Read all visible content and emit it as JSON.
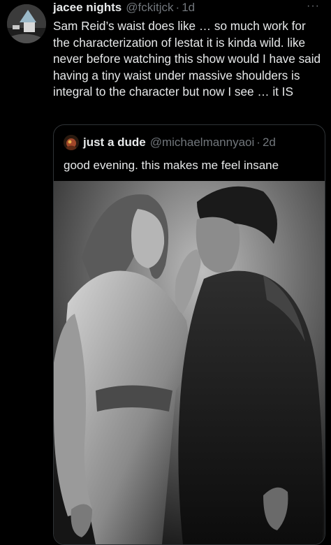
{
  "tweet": {
    "author_name": "jacee nights",
    "author_handle": "@fckitjck",
    "separator": "·",
    "time": "1d",
    "more_label": "···",
    "text": "Sam Reid’s waist does like … so much work for the characterization of lestat it is kinda wild. like never before watching this show would I have said having a tiny waist under massive shoulders is integral to the character but now I see … it IS"
  },
  "quoted_tweet": {
    "author_name": "just a dude",
    "author_handle": "@michaelmannyaoi",
    "separator": "·",
    "time": "2d",
    "text": "good evening. this makes me feel insane"
  },
  "colors": {
    "background": "#000000",
    "text_primary": "#e7e9ea",
    "text_secondary": "#71767b",
    "border": "#2f3336"
  },
  "icons": {
    "author_avatar": "avatar-image",
    "quoted_avatar": "avatar-image",
    "more": "more-icon"
  }
}
